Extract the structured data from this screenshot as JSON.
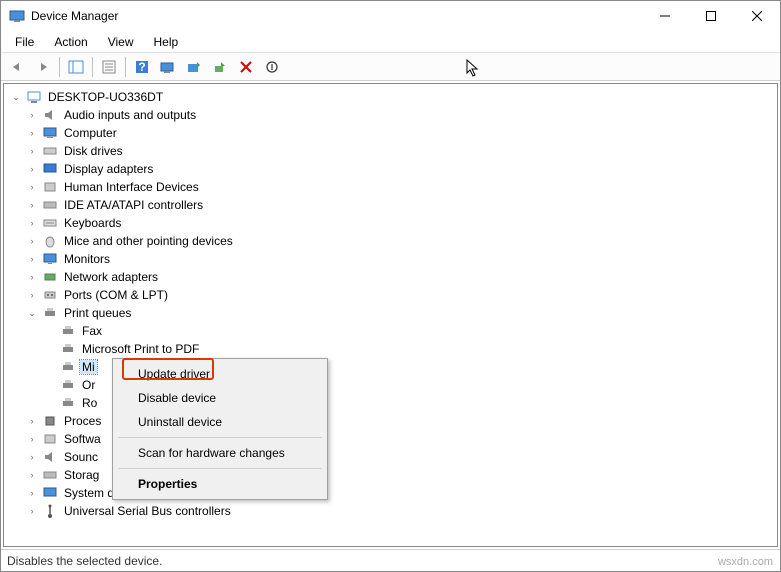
{
  "window": {
    "title": "Device Manager"
  },
  "menu": {
    "file": "File",
    "action": "Action",
    "view": "View",
    "help": "Help"
  },
  "root": "DESKTOP-UO336DT",
  "categories": {
    "audio": "Audio inputs and outputs",
    "computer": "Computer",
    "disk": "Disk drives",
    "display": "Display adapters",
    "hid": "Human Interface Devices",
    "ide": "IDE ATA/ATAPI controllers",
    "keyboards": "Keyboards",
    "mice": "Mice and other pointing devices",
    "monitors": "Monitors",
    "network": "Network adapters",
    "ports": "Ports (COM & LPT)",
    "printqueues": "Print queues",
    "processors": "Processors",
    "software": "Software devices",
    "sound": "Sound, video and game controllers",
    "storage": "Storage controllers",
    "system": "System devices",
    "usb": "Universal Serial Bus controllers"
  },
  "print_children": {
    "fax": "Fax",
    "mspdf": "Microsoft Print to PDF",
    "msxps": "Microsoft XPS Document Writer",
    "onenote": "OneNote",
    "root": "Root Print Queue"
  },
  "partial": {
    "proc": "Proces",
    "soft": "Softwa",
    "sound": "Sounc",
    "stor": "Storag"
  },
  "context": {
    "update": "Update driver",
    "disable": "Disable device",
    "uninstall": "Uninstall device",
    "scan": "Scan for hardware changes",
    "properties": "Properties"
  },
  "status": "Disables the selected device.",
  "watermark": "wsxdn.com"
}
